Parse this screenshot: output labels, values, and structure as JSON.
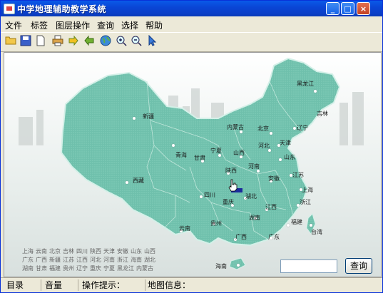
{
  "window": {
    "title": "中学地理辅助教学系统"
  },
  "menu": [
    "文件",
    "标签",
    "图层操作",
    "查询",
    "选择",
    "帮助"
  ],
  "toolbar": [
    "open-folder-icon",
    "save-icon",
    "new-document-icon",
    "print-icon",
    "forward-arrow-icon",
    "back-arrow-icon",
    "globe-icon",
    "zoom-in-icon",
    "zoom-out-icon",
    "pointer-icon"
  ],
  "map": {
    "cities": [
      "黑龙江",
      "吉林",
      "辽宁",
      "内蒙古",
      "北京",
      "天津",
      "河北",
      "山西",
      "山东",
      "宁夏",
      "甘肃",
      "陕西",
      "河南",
      "江苏",
      "上海",
      "安徽",
      "湖北",
      "浙江",
      "四川",
      "重庆",
      "江西",
      "湖南",
      "福建",
      "贵州",
      "云南",
      "广西",
      "广东",
      "海南",
      "新疆",
      "青海",
      "西藏",
      "台湾"
    ],
    "prov_list": [
      [
        "上海",
        "云南",
        "北京",
        "吉林",
        "四川",
        "陕西",
        "天津",
        "安徽",
        "山东",
        "山西"
      ],
      [
        "广东",
        "广西",
        "新疆",
        "江苏",
        "江西",
        "河北",
        "河南",
        "浙江",
        "海南",
        "湖北"
      ],
      [
        "湖南",
        "甘肃",
        "福建",
        "贵州",
        "辽宁",
        "重庆",
        "宁夏",
        "黑龙江",
        "内蒙古"
      ]
    ]
  },
  "search": {
    "value": "",
    "button": "查询"
  },
  "status": {
    "catalog": "目录",
    "volume": "音量",
    "hint_label": "操作提示：",
    "info_label": "地图信息："
  }
}
